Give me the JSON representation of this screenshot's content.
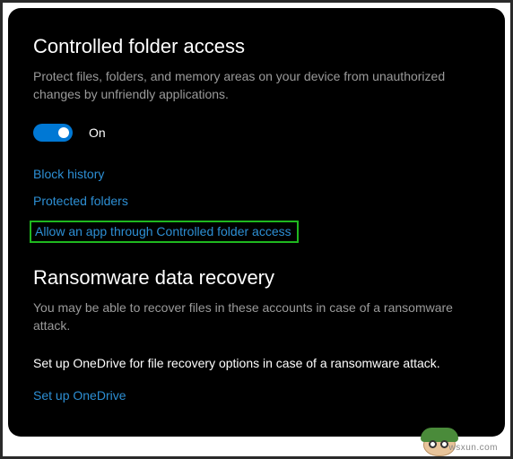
{
  "cfa": {
    "title": "Controlled folder access",
    "description": "Protect files, folders, and memory areas on your device from unauthorized changes by unfriendly applications.",
    "toggle_state": "On",
    "links": {
      "block_history": "Block history",
      "protected_folders": "Protected folders",
      "allow_app": "Allow an app through Controlled folder access"
    }
  },
  "rdr": {
    "title": "Ransomware data recovery",
    "description": "You may be able to recover files in these accounts in case of a ransomware attack.",
    "instruction": "Set up OneDrive for file recovery options in case of a ransomware attack.",
    "link": "Set up OneDrive"
  },
  "watermark": "wsxun.com"
}
